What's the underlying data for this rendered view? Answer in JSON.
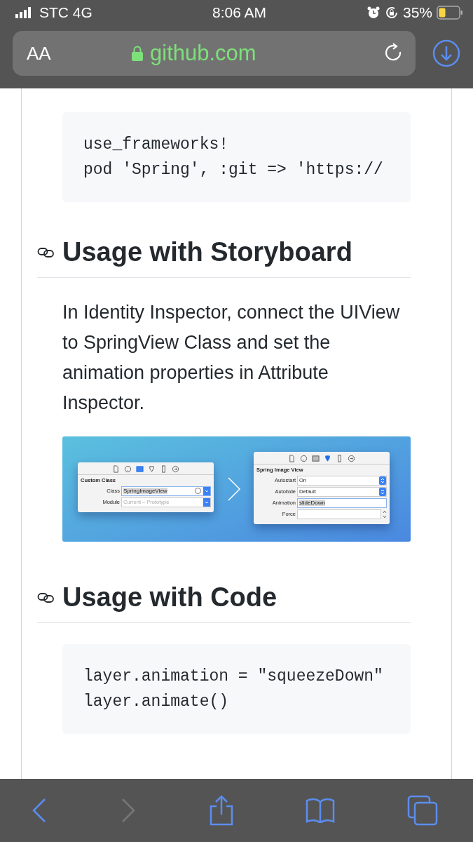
{
  "status_bar": {
    "carrier": "STC 4G",
    "time": "8:06 AM",
    "battery": "35%"
  },
  "address_bar": {
    "text_size": "AA",
    "url": "github.com"
  },
  "content": {
    "install_code": [
      "use_frameworks!",
      "pod 'Spring', :git => 'https://"
    ],
    "storyboard_heading": "Usage with Storyboard",
    "storyboard_text": "In Identity Inspector, connect the UIView to SpringView Class and set the animation properties in Attribute Inspector.",
    "storyboard_image": {
      "left_panel": {
        "tabs": [
          {
            "selected": false
          },
          {
            "selected": false
          },
          {
            "selected": true
          },
          {
            "selected": false
          },
          {
            "selected": false
          },
          {
            "selected": false
          }
        ],
        "title": "Custom Class",
        "fields": [
          {
            "label": "Class",
            "value": "SpringImageView",
            "kind": "combo"
          },
          {
            "label": "Module",
            "placeholder": "Current – Prototype",
            "kind": "combo"
          }
        ]
      },
      "right_panel": {
        "tabs": [
          {
            "selected": false
          },
          {
            "selected": false
          },
          {
            "selected": false
          },
          {
            "selected": true
          },
          {
            "selected": false
          },
          {
            "selected": false
          }
        ],
        "title": "Spring Image View",
        "fields": [
          {
            "label": "Autostart",
            "value": "On",
            "kind": "popup"
          },
          {
            "label": "Autohide",
            "value": "Default",
            "kind": "popup"
          },
          {
            "label": "Animation",
            "value": "slideDown",
            "kind": "text"
          },
          {
            "label": "Force",
            "kind": "stepper"
          }
        ]
      }
    },
    "code_heading": "Usage with Code",
    "usage_code": [
      "layer.animation = \"squeezeDown\"",
      "layer.animate()"
    ]
  },
  "toolbar": {
    "back_disabled": false,
    "forward_disabled": true
  }
}
